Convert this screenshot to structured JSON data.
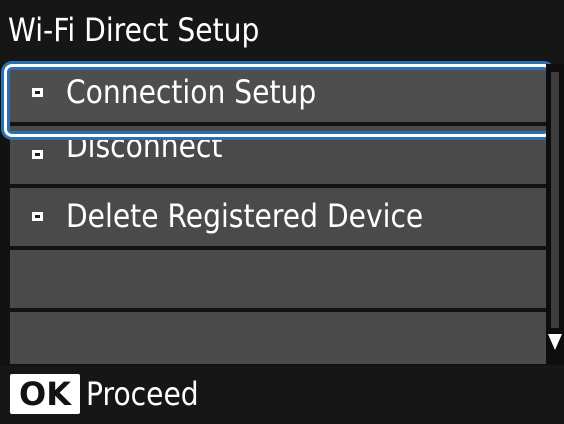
{
  "title": "Wi-Fi Direct Setup",
  "menu": {
    "items": [
      {
        "label": "Connection Setup",
        "selected": true
      },
      {
        "label": "Disconnect",
        "selected": false
      },
      {
        "label": "Delete Registered Device",
        "selected": false
      },
      {
        "label": "",
        "selected": false
      },
      {
        "label": "",
        "selected": false
      }
    ]
  },
  "scroll": {
    "arrow_icon": "triangle-down-icon"
  },
  "footer": {
    "key_label": "OK",
    "action_label": "Proceed"
  },
  "colors": {
    "screen_background": "#121212",
    "row_background": "#4a4a4a",
    "focus_ring": "#2e6fb0",
    "text": "#ffffff"
  }
}
